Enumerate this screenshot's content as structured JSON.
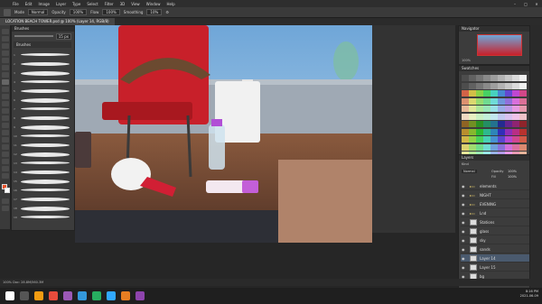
{
  "window": {
    "menu": [
      "File",
      "Edit",
      "Image",
      "Layer",
      "Type",
      "Select",
      "Filter",
      "3D",
      "View",
      "Window",
      "Help"
    ],
    "controls": [
      "–",
      "□",
      "✕"
    ]
  },
  "options_bar": {
    "mode_label": "Mode",
    "mode_value": "Normal",
    "opacity_label": "Opacity",
    "opacity_value": "100%",
    "flow_label": "Flow",
    "flow_value": "100%",
    "smoothing_label": "Smoothing",
    "smoothing_value": "10%"
  },
  "document_tab": "LOCATION BEACH TOWER.psd @ 100% (Layer 14, RGB/8)",
  "brush_panel": {
    "title": "Brushes",
    "size_value": "15 px",
    "folder_label": "Brushes",
    "rows": [
      "1",
      "2",
      "3",
      "4",
      "5",
      "6",
      "7",
      "8",
      "9",
      "10",
      "11",
      "12",
      "13",
      "14",
      "15",
      "16",
      "17",
      "18",
      "19"
    ]
  },
  "navigator_panel": {
    "title": "Navigator",
    "zoom": "100%"
  },
  "swatches_panel": {
    "title": "Swatches"
  },
  "layers_panel": {
    "title": "Layers",
    "kind_label": "Kind",
    "blend_mode": "Normal",
    "opacity_label": "Opacity",
    "opacity_value": "100%",
    "fill_label": "Fill",
    "fill_value": "100%",
    "layers": [
      {
        "name": "elements",
        "type": "folder",
        "selected": false
      },
      {
        "name": "NIGHT",
        "type": "folder",
        "selected": false
      },
      {
        "name": "EVENING",
        "type": "folder",
        "selected": false
      },
      {
        "name": "Lnd",
        "type": "folder",
        "selected": false
      },
      {
        "name": "Stations",
        "type": "layer",
        "selected": false
      },
      {
        "name": "glass",
        "type": "layer",
        "selected": false
      },
      {
        "name": "sky",
        "type": "layer",
        "selected": false
      },
      {
        "name": "sands",
        "type": "layer",
        "selected": false
      },
      {
        "name": "Layer 14",
        "type": "layer",
        "selected": true
      },
      {
        "name": "Layer 15",
        "type": "layer",
        "selected": false
      },
      {
        "name": "bg",
        "type": "layer",
        "selected": false
      }
    ]
  },
  "status_bar": "100%   Doc: 28.8M/560.3M",
  "taskbar": {
    "time": "8:16 PM",
    "date": "2021-06-09"
  },
  "colors": {
    "foreground": "#e8522a",
    "background": "#ffffff",
    "photoshop_blue": "#31a8ff"
  }
}
